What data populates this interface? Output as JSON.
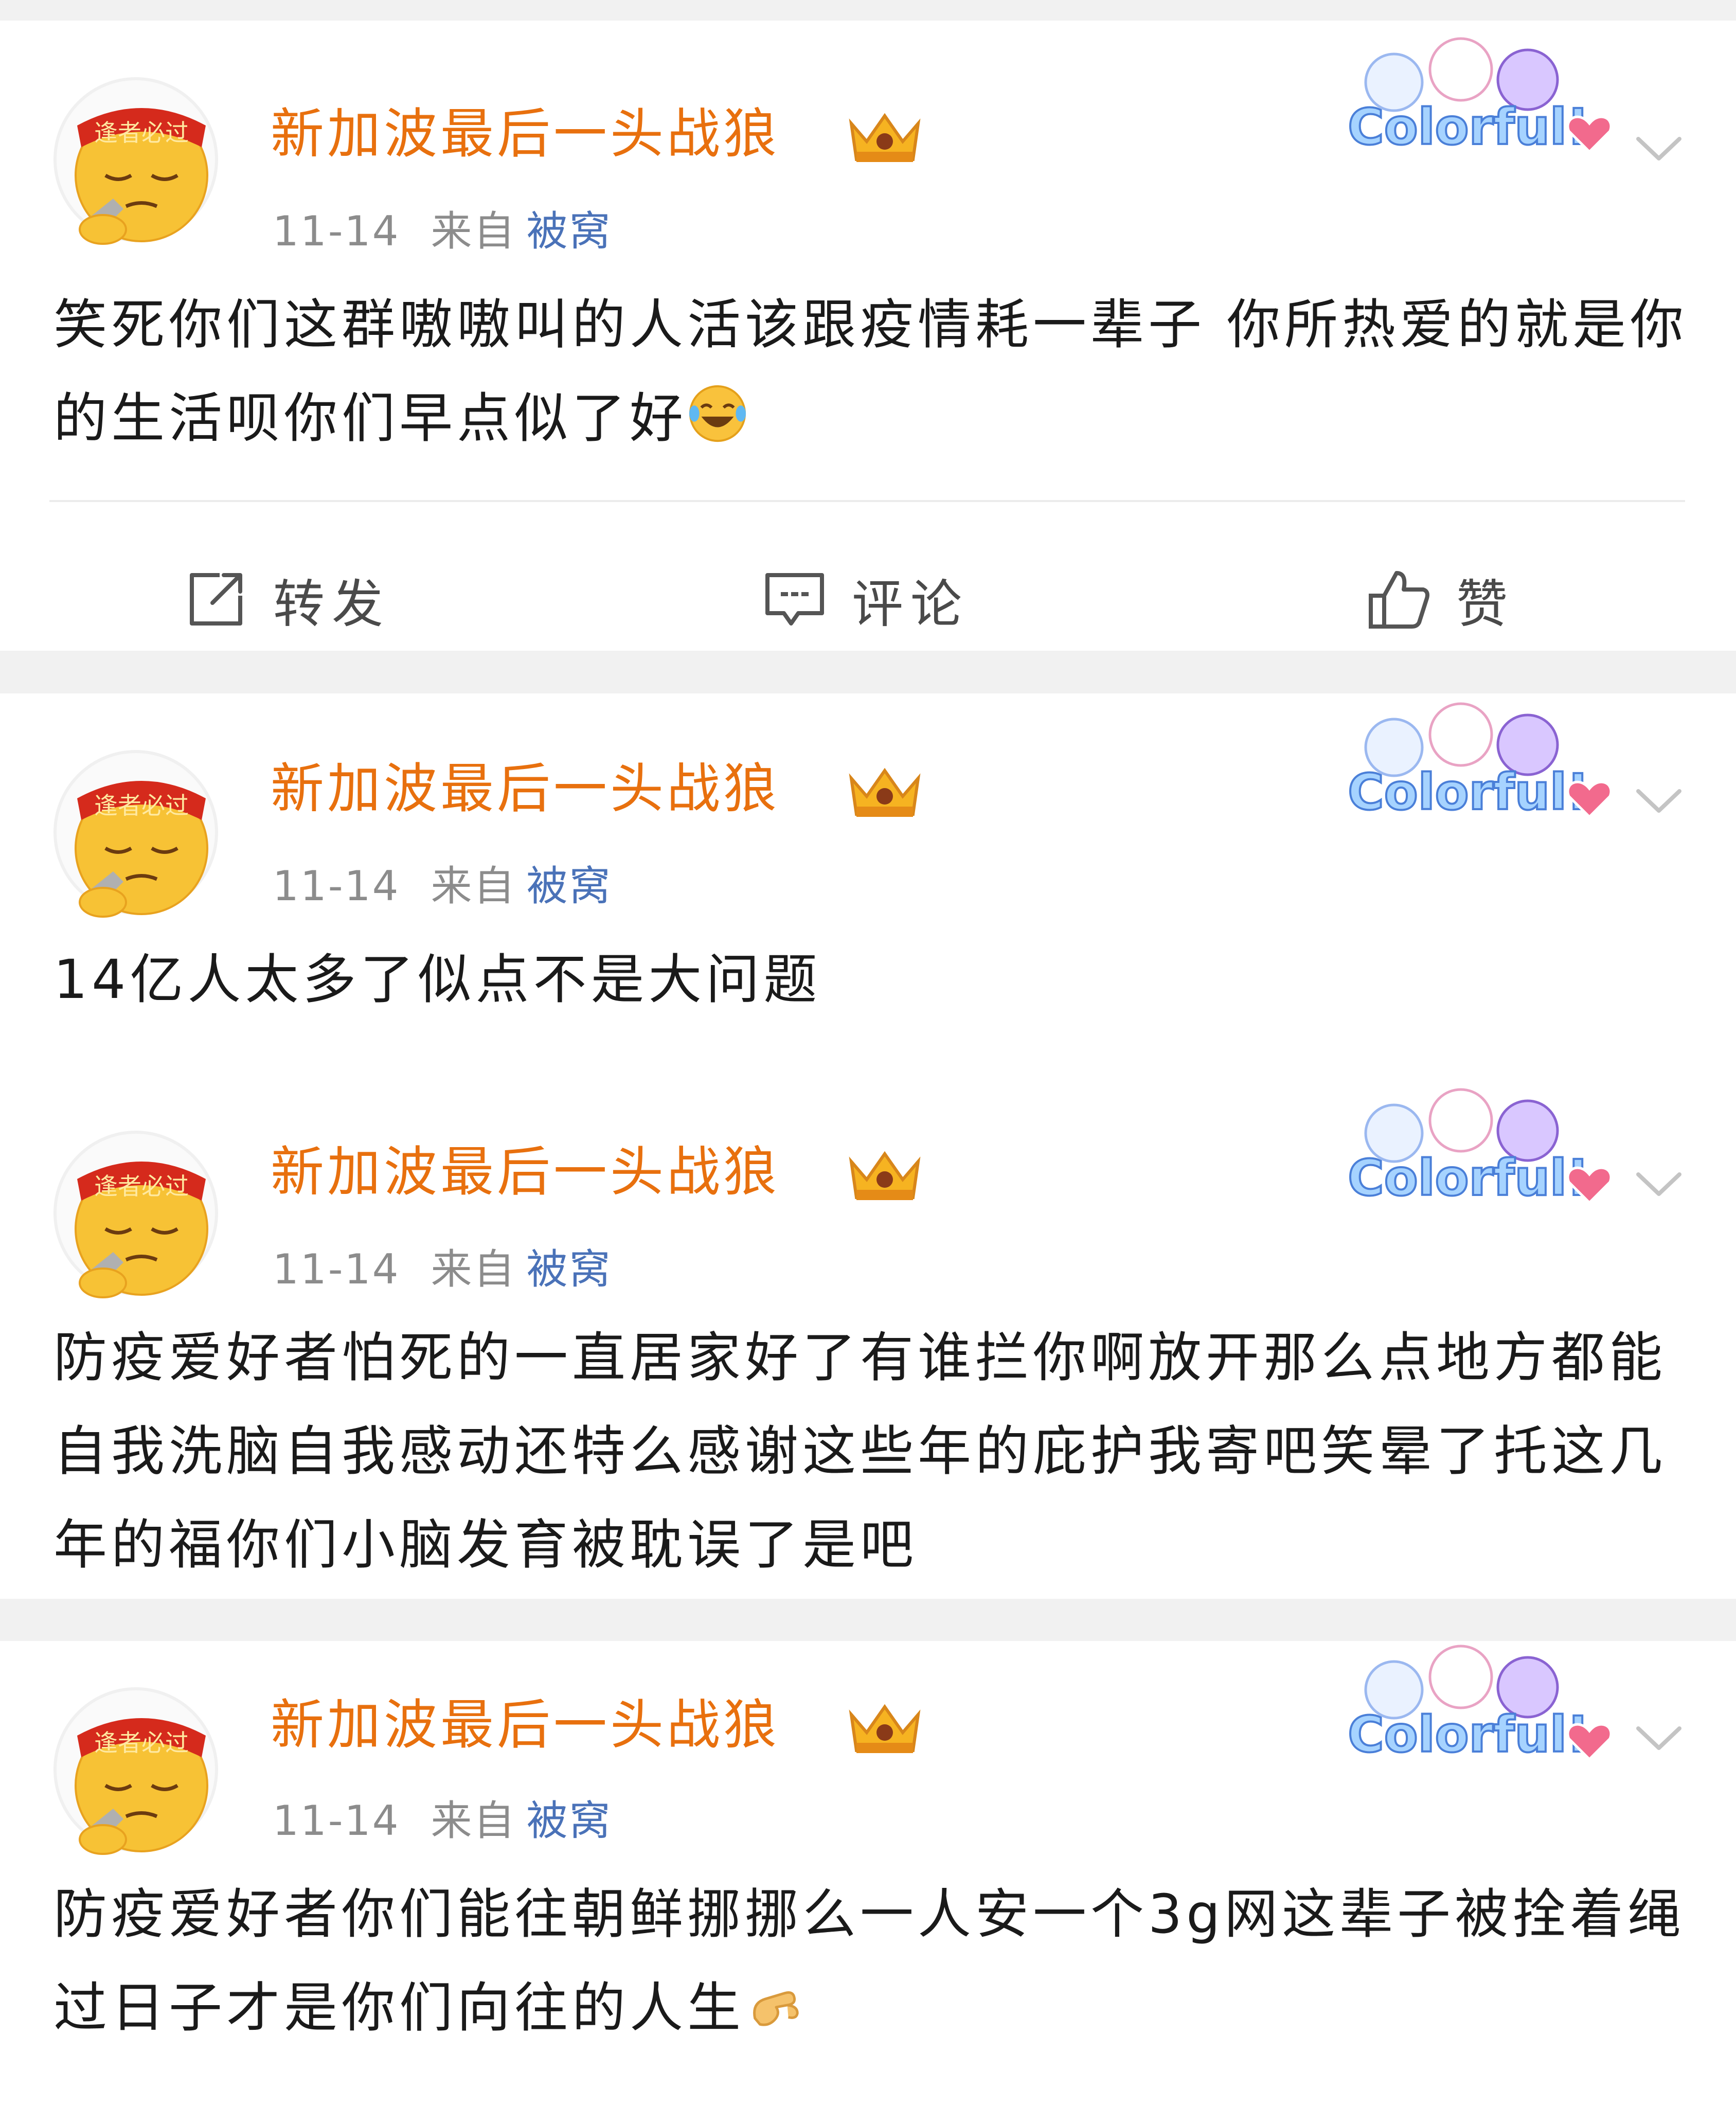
{
  "posts": [
    {
      "username": "新加波最后一头战狼",
      "date": "11-14",
      "from_label": "来自",
      "source": "被窝",
      "avatar_banner": "逢者必过",
      "badge_text": "Colorful!",
      "content": "笑死你们这群嗷嗷叫的人活该跟疫情耗一辈子 你所热爱的就是你的生活呗你们早点似了好",
      "trailing_emoji": "laughing-tears-emoji"
    },
    {
      "username": "新加波最后一头战狼",
      "date": "11-14",
      "from_label": "来自",
      "source": "被窝",
      "avatar_banner": "逢者必过",
      "badge_text": "Colorful!",
      "content": "14亿人太多了似点不是大问题"
    },
    {
      "username": "新加波最后一头战狼",
      "date": "11-14",
      "from_label": "来自",
      "source": "被窝",
      "avatar_banner": "逢者必过",
      "badge_text": "Colorful!",
      "content": "防疫爱好者怕死的一直居家好了有谁拦你啊放开那么点地方都能自我洗脑自我感动还特么感谢这些年的庇护我寄吧笑晕了托这几年的福你们小脑发育被耽误了是吧"
    },
    {
      "username": "新加波最后一头战狼",
      "date": "11-14",
      "from_label": "来自",
      "source": "被窝",
      "avatar_banner": "逢者必过",
      "badge_text": "Colorful!",
      "content": "防疫爱好者你们能往朝鲜挪挪么一人安一个3g网这辈子被拴着绳过日子才是你们向往的人生",
      "trailing_emoji": "beckoning-hand-emoji"
    }
  ],
  "actions": {
    "repost": "转发",
    "comment": "评论",
    "like": "赞"
  },
  "colors": {
    "username": "#e8700e",
    "source_link": "#4a72b8",
    "meta": "#8c8c8c",
    "page_bg": "#f1f1f1"
  }
}
